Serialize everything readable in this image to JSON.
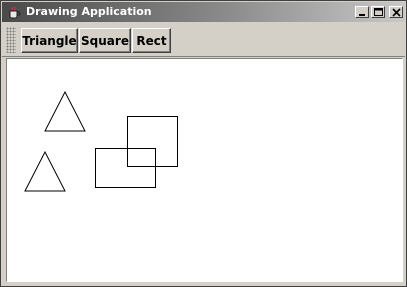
{
  "window": {
    "title": "Drawing Application",
    "app_icon": "coffee-cup-icon",
    "controls": {
      "minimize": "minimize-icon",
      "maximize": "maximize-icon",
      "close": "close-icon"
    }
  },
  "toolbar": {
    "buttons": [
      {
        "label": "Triangle"
      },
      {
        "label": "Square"
      },
      {
        "label": "Rect"
      }
    ]
  },
  "canvas": {
    "shapes": [
      {
        "type": "triangle"
      },
      {
        "type": "triangle"
      },
      {
        "type": "square"
      },
      {
        "type": "rect"
      }
    ]
  },
  "colors": {
    "canvas_background": "#ffffff",
    "stroke": "#000000",
    "chrome": "#d4d0c8"
  }
}
